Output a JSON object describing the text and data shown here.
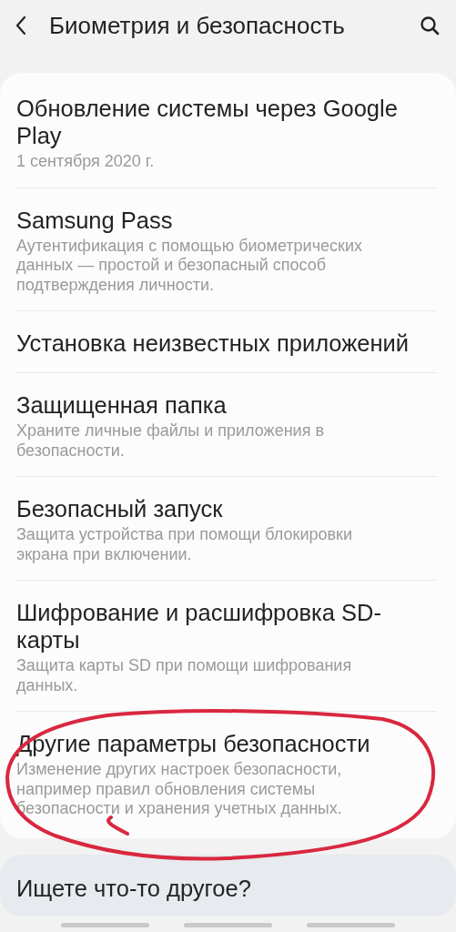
{
  "header": {
    "title": "Биометрия и безопасность"
  },
  "items": [
    {
      "title": "Обновление системы через Google Play",
      "subtitle": "1 сентября 2020 г.",
      "circled": false
    },
    {
      "title": "Samsung Pass",
      "subtitle": "Аутентификация с помощью биометрических данных — простой и безопасный способ подтверждения личности.",
      "circled": false
    },
    {
      "title": "Установка неизвестных приложений",
      "circled": false
    },
    {
      "title": "Защищенная папка",
      "subtitle": "Храните личные файлы и приложения в безопасности.",
      "circled": false
    },
    {
      "title": "Безопасный запуск",
      "subtitle": "Защита устройства при помощи блокировки экрана при включении.",
      "circled": false
    },
    {
      "title": "Шифрование и расшифровка SD-карты",
      "subtitle": "Защита карты SD при помощи шифрования данных.",
      "circled": false
    },
    {
      "title": "Другие параметры безопасности",
      "subtitle": "Изменение других настроек безопасности, например правил обновления системы безопасности и хранения учетных данных.",
      "circled": true
    }
  ],
  "annotation": {
    "color": "#d8283f"
  },
  "suggestions": {
    "title": "Ищете что-то другое?"
  }
}
